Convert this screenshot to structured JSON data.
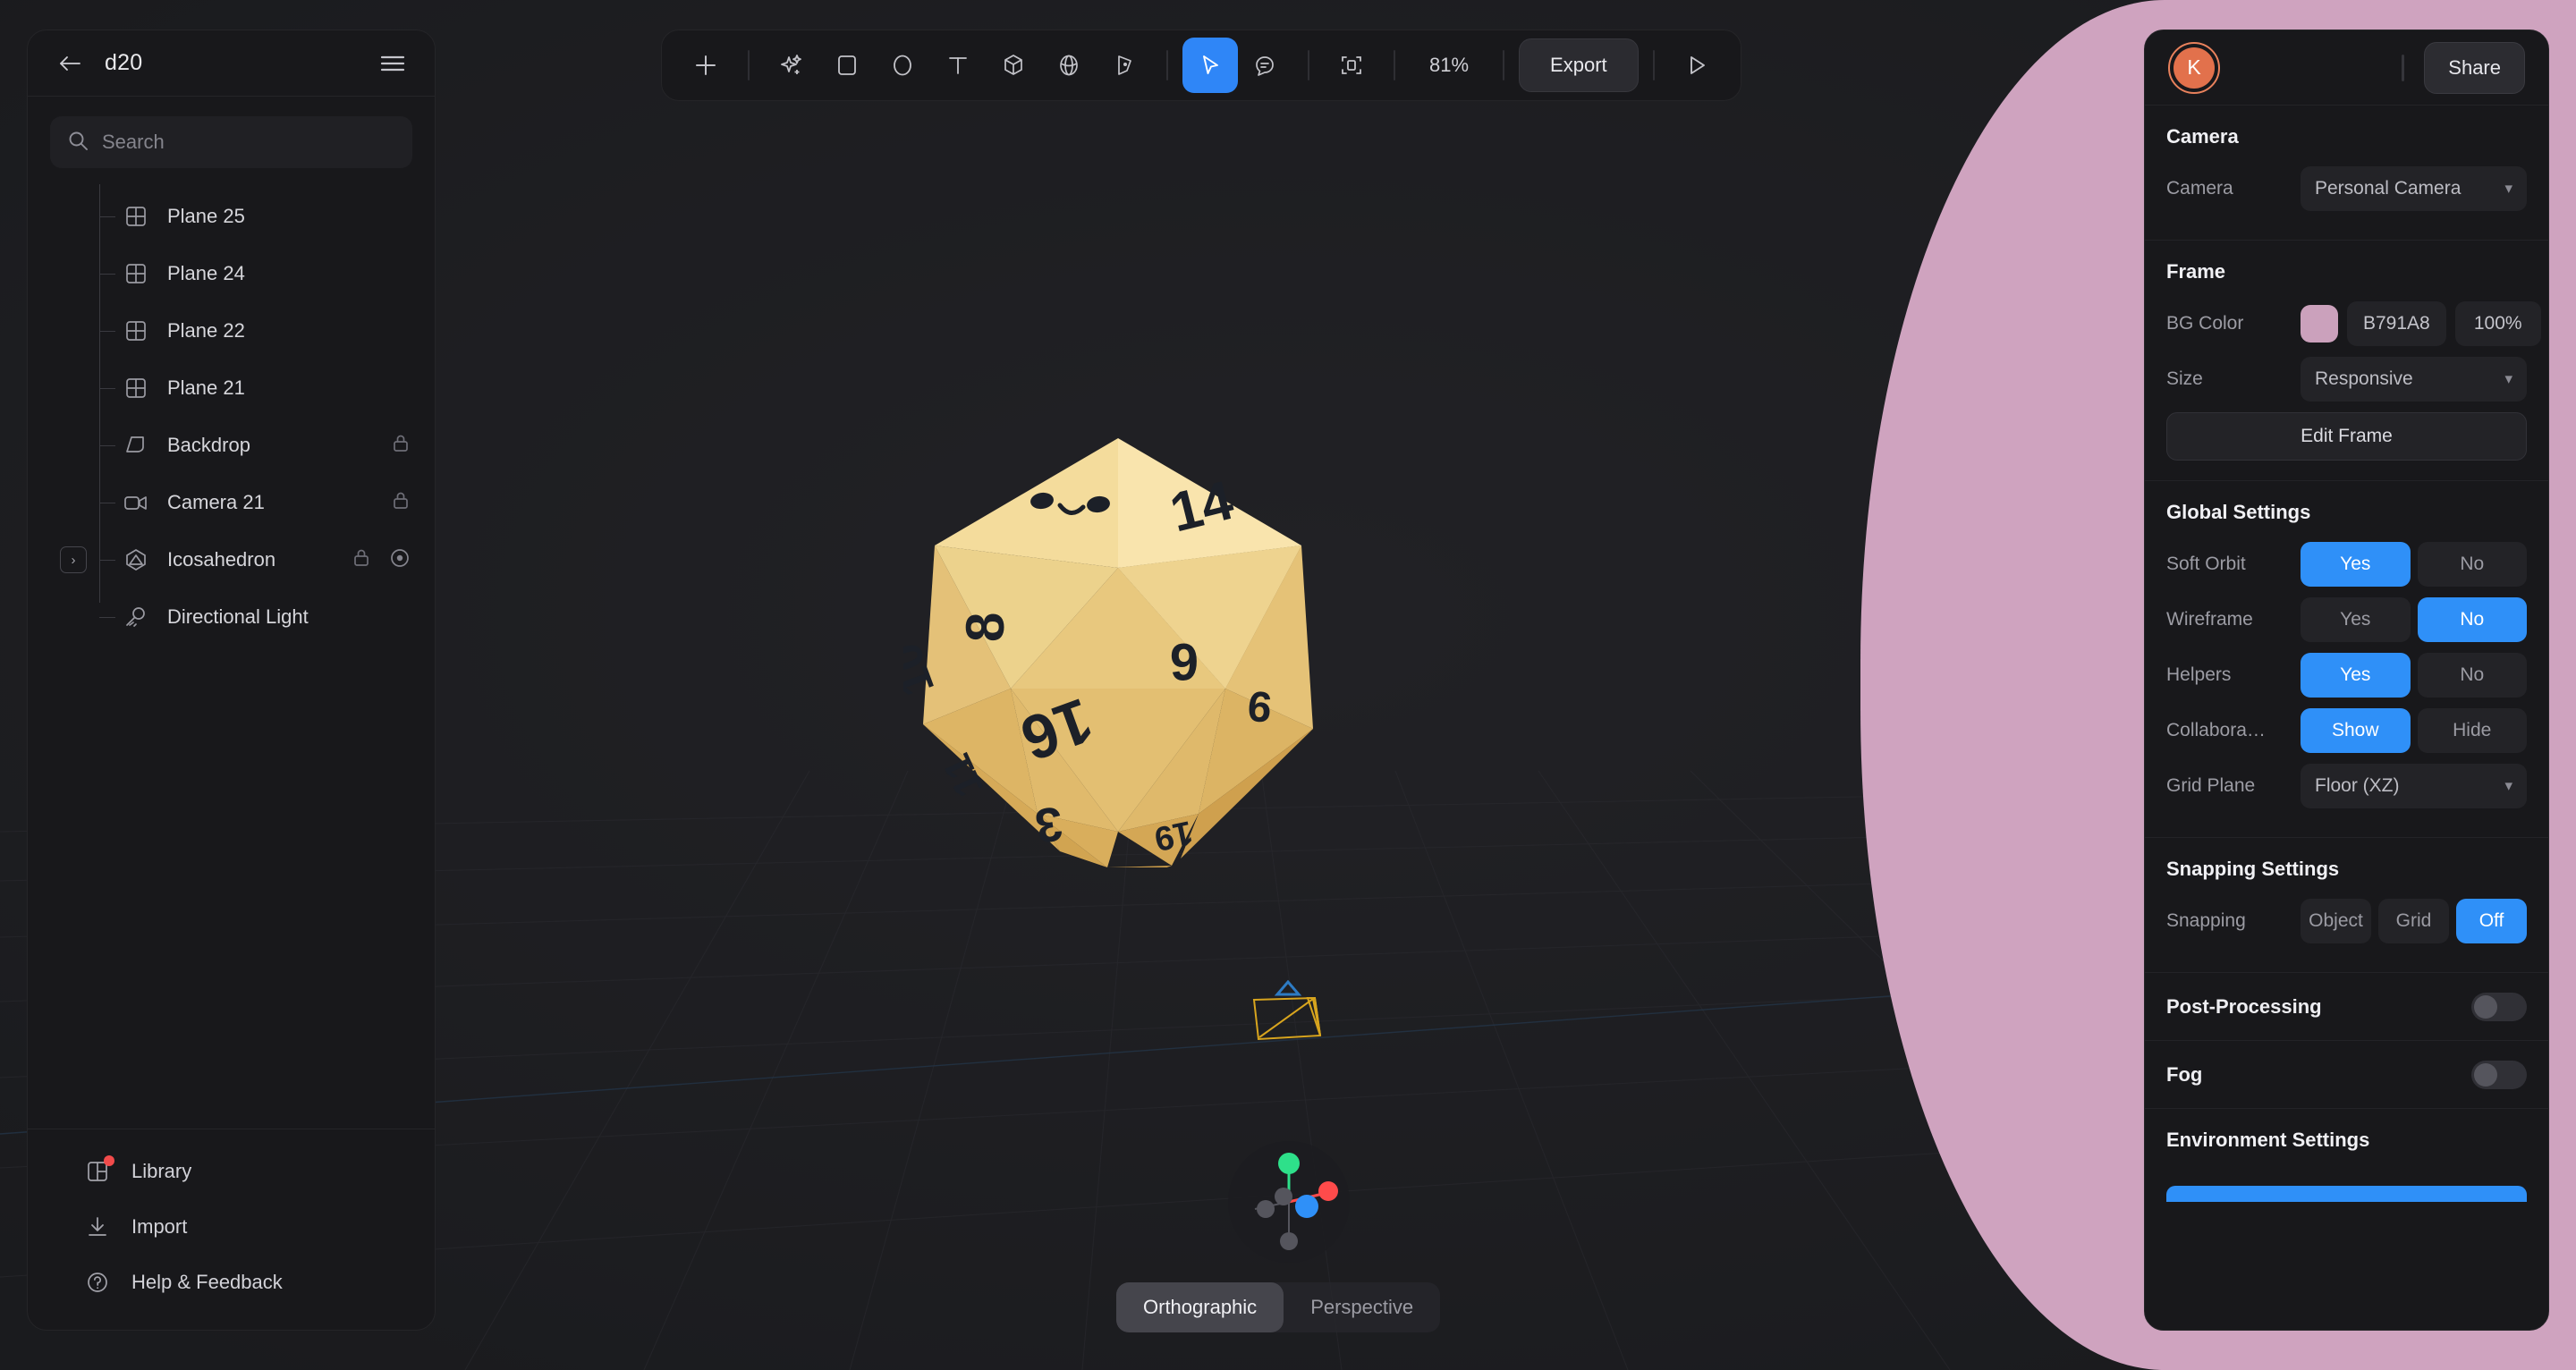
{
  "app": {
    "project_title": "d20"
  },
  "left_panel": {
    "back_icon": "arrow-left-icon",
    "menu_icon": "hamburger-menu-icon",
    "search": {
      "placeholder": "Search",
      "value": "",
      "icon": "search-icon"
    },
    "layers": [
      {
        "label": "Plane 25",
        "icon": "plane-icon",
        "locked": false,
        "has_twisty": false,
        "visibility_dot": false
      },
      {
        "label": "Plane 24",
        "icon": "plane-icon",
        "locked": false,
        "has_twisty": false,
        "visibility_dot": false
      },
      {
        "label": "Plane 22",
        "icon": "plane-icon",
        "locked": false,
        "has_twisty": false,
        "visibility_dot": false
      },
      {
        "label": "Plane 21",
        "icon": "plane-icon",
        "locked": false,
        "has_twisty": false,
        "visibility_dot": false
      },
      {
        "label": "Backdrop",
        "icon": "backdrop-icon",
        "locked": true,
        "has_twisty": false,
        "visibility_dot": false
      },
      {
        "label": "Camera 21",
        "icon": "camera-icon",
        "locked": true,
        "has_twisty": false,
        "visibility_dot": false
      },
      {
        "label": "Icosahedron",
        "icon": "polyhedron-icon",
        "locked": true,
        "has_twisty": true,
        "visibility_dot": true
      },
      {
        "label": "Directional Light",
        "icon": "light-icon",
        "locked": false,
        "has_twisty": false,
        "visibility_dot": false
      }
    ],
    "footer": [
      {
        "label": "Library",
        "icon": "library-icon",
        "badge": true
      },
      {
        "label": "Import",
        "icon": "import-icon",
        "badge": false
      },
      {
        "label": "Help & Feedback",
        "icon": "help-icon",
        "badge": false
      }
    ]
  },
  "toolbar": {
    "tools": [
      {
        "name": "add-icon",
        "label": "Add",
        "active": false
      },
      {
        "name": "magic-wand-icon",
        "label": "AI Generate",
        "active": false
      },
      {
        "name": "square-icon",
        "label": "Rectangle",
        "active": false
      },
      {
        "name": "circle-icon",
        "label": "Ellipse",
        "active": false
      },
      {
        "name": "text-icon",
        "label": "Text",
        "active": false
      },
      {
        "name": "cube-icon",
        "label": "3D Shape",
        "active": false
      },
      {
        "name": "sphere-icon",
        "label": "Sphere",
        "active": false
      },
      {
        "name": "pen-icon",
        "label": "Pen",
        "active": false
      },
      {
        "name": "cursor-icon",
        "label": "Select",
        "active": true
      },
      {
        "name": "comment-icon",
        "label": "Comment",
        "active": false
      },
      {
        "name": "frame-icon",
        "label": "Frame",
        "active": false
      }
    ],
    "zoom_level": "81%",
    "export_label": "Export",
    "play_icon": "play-icon"
  },
  "viewport": {
    "projection": {
      "orthographic_label": "Orthographic",
      "perspective_label": "Perspective",
      "selected": "Orthographic"
    },
    "gizmo": {
      "axis_colors": {
        "x": "#ff4b4b",
        "y": "#2ee08a",
        "z": "#2f90f8",
        "neg": "#5a5a60"
      }
    },
    "object": {
      "name": "Icosahedron",
      "type": "d20",
      "body_color": "#e7c267",
      "face_numbers": [
        "14",
        "8",
        "6",
        "16",
        "10",
        "9",
        "11",
        "3",
        "19"
      ]
    },
    "camera_helper_color": "#d8a51e",
    "background_color": "#1d1d20"
  },
  "right_panel": {
    "avatar_initial": "K",
    "avatar_color": "#e2714c",
    "share_label": "Share",
    "sections": {
      "camera": {
        "title": "Camera",
        "camera_label": "Camera",
        "camera_value": "Personal Camera"
      },
      "frame": {
        "title": "Frame",
        "bg_color_label": "BG Color",
        "bg_color_hex": "B791A8",
        "bg_color_swatch": "#cba1bc",
        "bg_color_opacity": "100%",
        "size_label": "Size",
        "size_value": "Responsive",
        "edit_frame_label": "Edit Frame"
      },
      "global": {
        "title": "Global Settings",
        "rows": [
          {
            "label": "Soft Orbit",
            "options": [
              "Yes",
              "No"
            ],
            "selected": "Yes"
          },
          {
            "label": "Wireframe",
            "options": [
              "Yes",
              "No"
            ],
            "selected": "No"
          },
          {
            "label": "Helpers",
            "options": [
              "Yes",
              "No"
            ],
            "selected": "Yes"
          },
          {
            "label": "Collabora…",
            "options": [
              "Show",
              "Hide"
            ],
            "selected": "Show"
          }
        ],
        "grid_plane_label": "Grid Plane",
        "grid_plane_value": "Floor (XZ)"
      },
      "snapping": {
        "title": "Snapping Settings",
        "label": "Snapping",
        "options": [
          "Object",
          "Grid",
          "Off"
        ],
        "selected": "Off"
      },
      "post_processing": {
        "label": "Post-Processing",
        "enabled": false
      },
      "fog": {
        "label": "Fog",
        "enabled": false
      },
      "environment": {
        "title": "Environment Settings"
      }
    },
    "accent_color": "#2f90f8"
  }
}
